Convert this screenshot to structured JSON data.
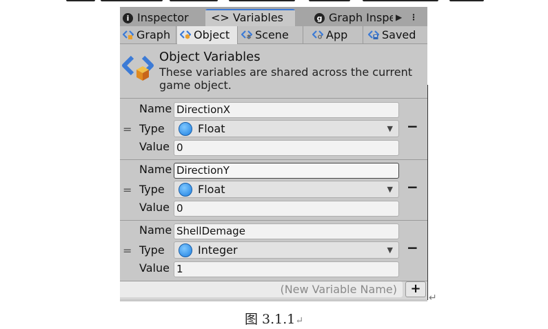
{
  "window_tabs": {
    "inspector": {
      "icon": "info-icon",
      "label": "Inspector"
    },
    "variables": {
      "label": "<> Variables"
    },
    "graph_inspector": {
      "icon": "graph-icon",
      "label": "Graph Inspe"
    },
    "menu": {
      "play_icon": "▶",
      "kebab_icon": "⋮"
    }
  },
  "scope_tabs": [
    {
      "label": "Graph",
      "icon": "graph-variables-icon",
      "active": false
    },
    {
      "label": "Object",
      "icon": "object-variables-icon",
      "active": true
    },
    {
      "label": "Scene",
      "icon": "scene-variables-icon",
      "active": false
    },
    {
      "label": "App",
      "icon": "app-variables-icon",
      "active": false
    },
    {
      "label": "Saved",
      "icon": "saved-variables-icon",
      "active": false
    }
  ],
  "header": {
    "icon": "object-variables-icon",
    "title": "Object Variables",
    "description": "These variables are shared across the current game object."
  },
  "labels": {
    "name": "Name",
    "type": "Type",
    "value": "Value"
  },
  "variables": [
    {
      "name": "DirectionX",
      "type": "Float",
      "value": "0",
      "focused": false
    },
    {
      "name": "DirectionY",
      "type": "Float",
      "value": "0",
      "focused": true
    },
    {
      "name": "ShellDemage",
      "type": "Integer",
      "value": "1",
      "focused": false
    }
  ],
  "controls": {
    "drag_handle": "=",
    "remove": "−",
    "dropdown_arrow": "▼"
  },
  "footer": {
    "new_variable_placeholder": "(New Variable Name)",
    "add_label": "+"
  },
  "caption": "图 3.1.1",
  "paragraph_mark": "↵",
  "colors": {
    "active_tab_accent": "#3a79d7",
    "type_icon": "#1e7fe0",
    "panel_bg": "#c8c8c8"
  }
}
